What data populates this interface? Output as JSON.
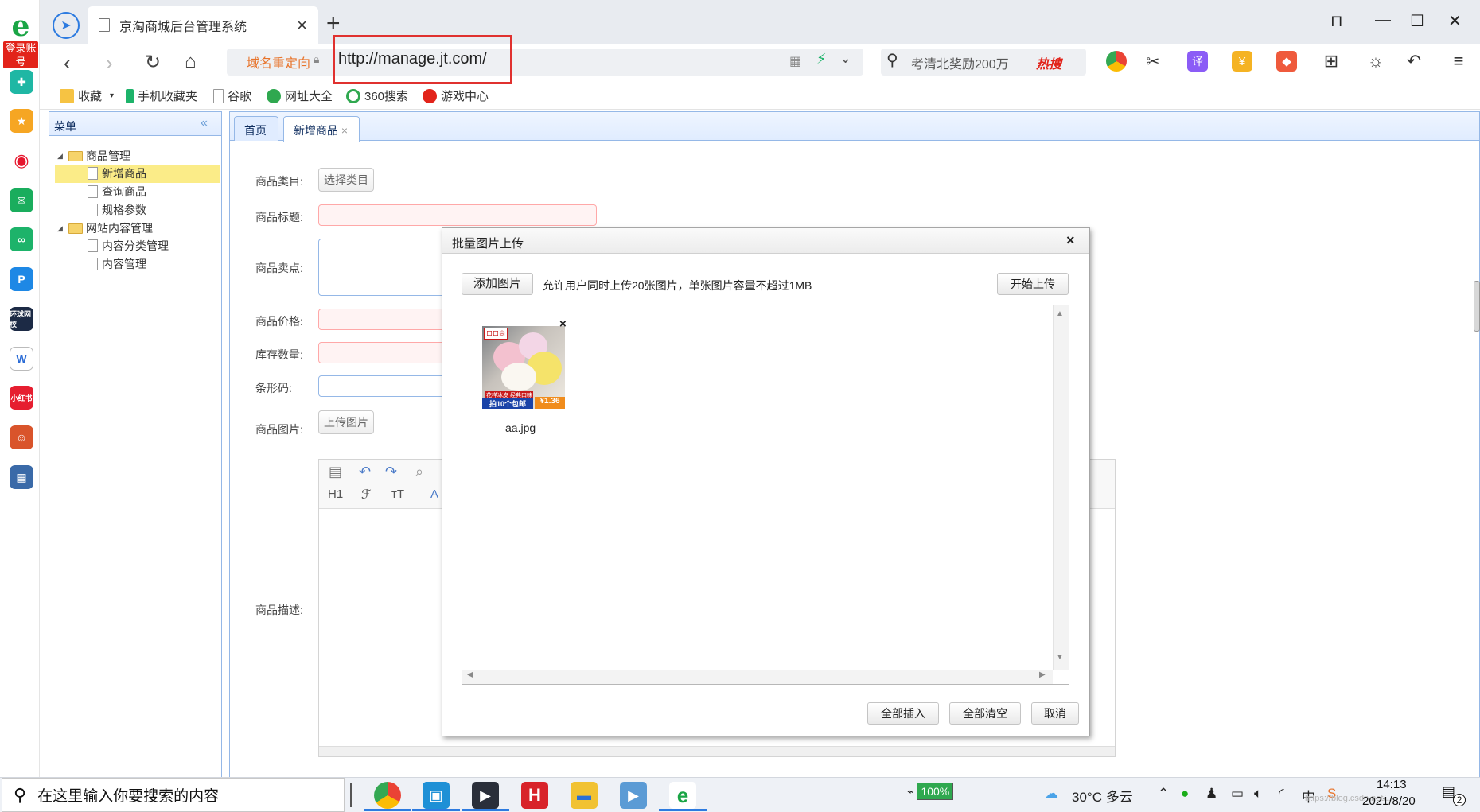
{
  "rail": {
    "account_label": "登录账号",
    "mini_label": "小红书",
    "news_label": "环球网校"
  },
  "browser": {
    "tab_title": "京淘商城后台管理系统",
    "new_tab_symbol": "+",
    "redirect_label": "域名重定向",
    "url": "http://manage.jt.com/",
    "search_placeholder": "考清北奖励200万",
    "hot_search": "热搜",
    "translate_label": "译",
    "window_controls": [
      "⊓",
      "—",
      "☐",
      "✕"
    ]
  },
  "bookmarks": [
    {
      "label": "收藏"
    },
    {
      "label": "手机收藏夹"
    },
    {
      "label": "谷歌"
    },
    {
      "label": "网址大全"
    },
    {
      "label": "360搜索"
    },
    {
      "label": "游戏中心"
    }
  ],
  "sidebar": {
    "title": "菜单",
    "collapse_icon": "«",
    "groups": [
      {
        "label": "商品管理",
        "items": [
          "新增商品",
          "查询商品",
          "规格参数"
        ]
      },
      {
        "label": "网站内容管理",
        "items": [
          "内容分类管理",
          "内容管理"
        ]
      }
    ],
    "selected_item": "新增商品"
  },
  "tabs": [
    {
      "label": "首页",
      "active": false
    },
    {
      "label": "新增商品",
      "active": true,
      "close": "×"
    }
  ],
  "form": {
    "category_label": "商品类目:",
    "category_button": "选择类目",
    "title_label": "商品标题:",
    "sellpoint_label": "商品卖点:",
    "price_label": "商品价格:",
    "stock_label": "库存数量:",
    "barcode_label": "条形码:",
    "image_label": "商品图片:",
    "image_button": "上传图片",
    "desc_label": "商品描述:",
    "editor_heading": "H1",
    "editor_font": "ℱ",
    "editor_size": "ᴛT",
    "editor_font_color": "A"
  },
  "dialog": {
    "title": "批量图片上传",
    "close": "×",
    "add_button": "添加图片",
    "hint": "允许用户同时上传20张图片，单张图片容量不超过1MB",
    "start_button": "开始上传",
    "files": [
      {
        "name": "aa.jpg",
        "badge": "口口尚",
        "caption1": "花样冰皮 经典口味",
        "caption2": "拍10个包邮",
        "price": "¥1.36"
      }
    ],
    "insert_all": "全部插入",
    "clear_all": "全部清空",
    "cancel": "取消"
  },
  "taskbar": {
    "search_placeholder": "在这里输入你要搜索的内容",
    "battery": "100%",
    "weather": "30°C 多云",
    "time": "14:13",
    "date": "2021/8/20",
    "notifications": "2",
    "watermark": "https://blog.csdn.net/..."
  },
  "colors": {
    "url_highlight": "#e0312f",
    "tree_selected": "#fbec88",
    "panel_border": "#95b8e7",
    "accent": "#2d7be0"
  }
}
